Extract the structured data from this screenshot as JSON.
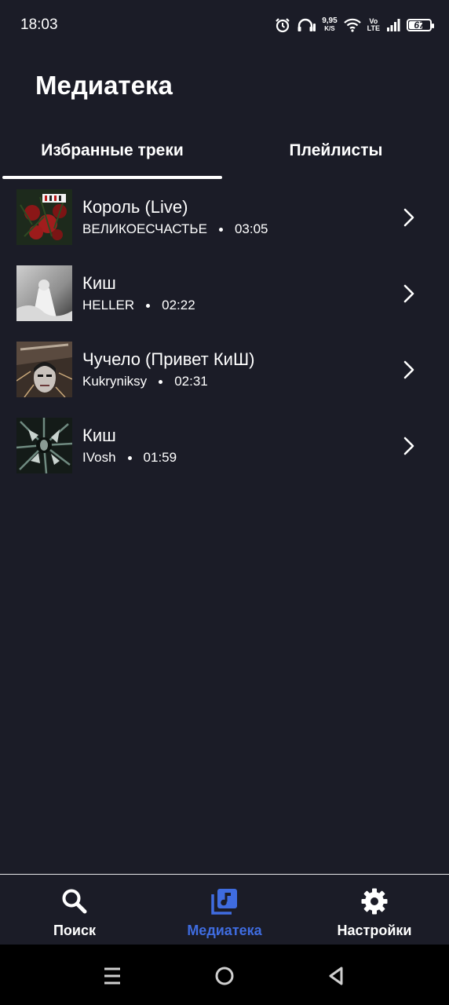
{
  "status_bar": {
    "time": "18:03",
    "net_speed": "9,95",
    "net_speed_unit": "K/S",
    "volte_top": "Vo",
    "volte_bottom": "LTE",
    "battery": "67",
    "battery_level": 0.67,
    "icons": [
      "alarm-icon",
      "headphones-icon",
      "wifi-icon",
      "signal-icon",
      "battery-icon"
    ]
  },
  "page": {
    "title": "Медиатека"
  },
  "tabs": [
    {
      "label": "Избранные треки",
      "active": true
    },
    {
      "label": "Плейлисты",
      "active": false
    }
  ],
  "tracks": [
    {
      "title": "Король (Live)",
      "artist": "ВЕЛИКОЕСЧАСТЬЕ",
      "duration": "03:05",
      "cover_label": "TYIKS"
    },
    {
      "title": "Киш",
      "artist": "HELLER",
      "duration": "02:22"
    },
    {
      "title": "Чучело (Привет КиШ)",
      "artist": "Kukryniksy",
      "duration": "02:31",
      "cover_label": "КУКРЫНИКСЫ"
    },
    {
      "title": "Киш",
      "artist": "IVosh",
      "duration": "01:59"
    }
  ],
  "bottom_nav": [
    {
      "label": "Поиск",
      "icon": "search-icon",
      "active": false
    },
    {
      "label": "Медиатека",
      "icon": "music-library-icon",
      "active": true
    },
    {
      "label": "Настройки",
      "icon": "gear-icon",
      "active": false
    }
  ],
  "colors": {
    "background": "#1b1c27",
    "accent": "#3f6ce0",
    "text": "#ffffff",
    "system_nav": "#000000"
  }
}
